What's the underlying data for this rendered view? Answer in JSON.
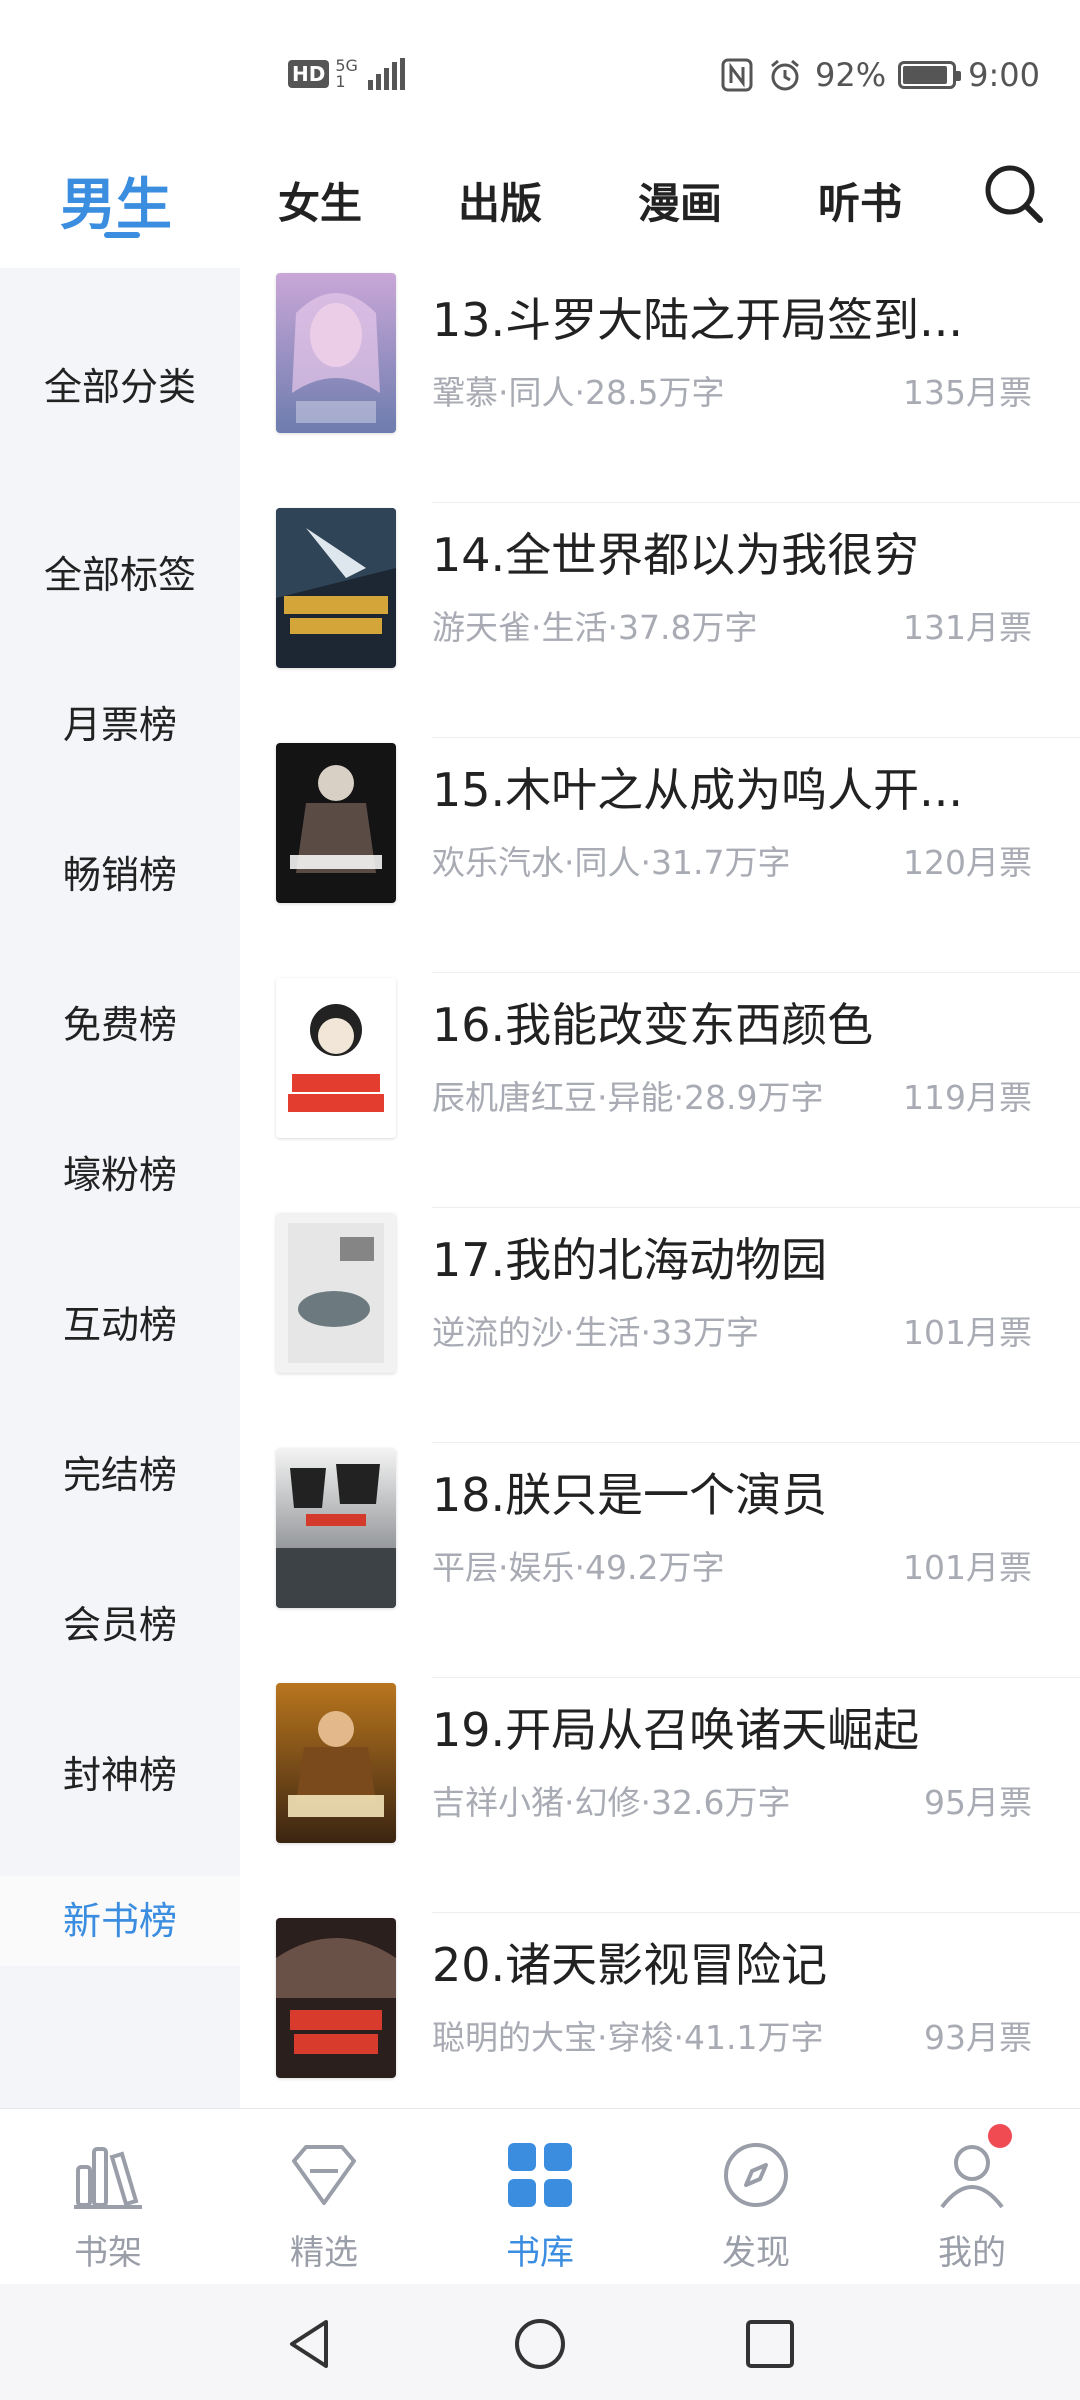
{
  "status_bar": {
    "hd": "HD",
    "network": "5G",
    "network_sub": "1",
    "battery_percent": "92%",
    "battery_level": 0.92,
    "time": "9:00"
  },
  "top_tabs": [
    {
      "label": "男生",
      "active": true
    },
    {
      "label": "女生",
      "active": false
    },
    {
      "label": "出版",
      "active": false
    },
    {
      "label": "漫画",
      "active": false
    },
    {
      "label": "听书",
      "active": false
    }
  ],
  "sidebar": {
    "items": [
      {
        "label": "全部分类"
      },
      {
        "label": "全部标签"
      },
      {
        "label": "月票榜"
      },
      {
        "label": "畅销榜"
      },
      {
        "label": "免费榜"
      },
      {
        "label": "壕粉榜"
      },
      {
        "label": "互动榜"
      },
      {
        "label": "完结榜"
      },
      {
        "label": "会员榜"
      },
      {
        "label": "封神榜"
      },
      {
        "label": "新书榜",
        "active": true
      }
    ]
  },
  "books": [
    {
      "title": "13.斗罗大陆之开局签到...",
      "meta": "鞏慕·同人·28.5万字",
      "votes": "135月票",
      "cover_text": "斗罗大陆之开局签到"
    },
    {
      "title": "14.全世界都以为我很穷",
      "meta": "游天雀·生活·37.8万字",
      "votes": "131月票",
      "cover_text": "全世界都以为我很穷"
    },
    {
      "title": "15.木叶之从成为鸣人开...",
      "meta": "欢乐汽水·同人·31.7万字",
      "votes": "120月票",
      "cover_text": "鸣人开始复仇"
    },
    {
      "title": "16.我能改变东西颜色",
      "meta": "辰机唐红豆·异能·28.9万字",
      "votes": "119月票",
      "cover_text": "我能改变东西颜色"
    },
    {
      "title": "17.我的北海动物园",
      "meta": "逆流的沙·生活·33万字",
      "votes": "101月票",
      "cover_text": "我的北海动物园"
    },
    {
      "title": "18.朕只是一个演员",
      "meta": "平层·娱乐·49.2万字",
      "votes": "101月票",
      "cover_text": "朕只是"
    },
    {
      "title": "19.开局从召唤诸天崛起",
      "meta": "吉祥小猪·幻修·32.6万字",
      "votes": "95月票",
      "cover_text": "诸天崛起"
    },
    {
      "title": "20.诸天影视冒险记",
      "meta": "聪明的大宝·穿梭·41.1万字",
      "votes": "93月票",
      "cover_text": "诸天影视冒险记"
    }
  ],
  "bottom_nav": [
    {
      "label": "书架",
      "icon": "bookshelf-icon",
      "active": false
    },
    {
      "label": "精选",
      "icon": "diamond-icon",
      "active": false
    },
    {
      "label": "书库",
      "icon": "grid-icon",
      "active": true
    },
    {
      "label": "发现",
      "icon": "compass-icon",
      "active": false
    },
    {
      "label": "我的",
      "icon": "profile-icon",
      "active": false
    }
  ],
  "colors": {
    "accent": "#3b8de0",
    "badge": "#f04b52",
    "muted_text": "#a8abb3",
    "sidebar_bg": "#f4f5f9"
  }
}
